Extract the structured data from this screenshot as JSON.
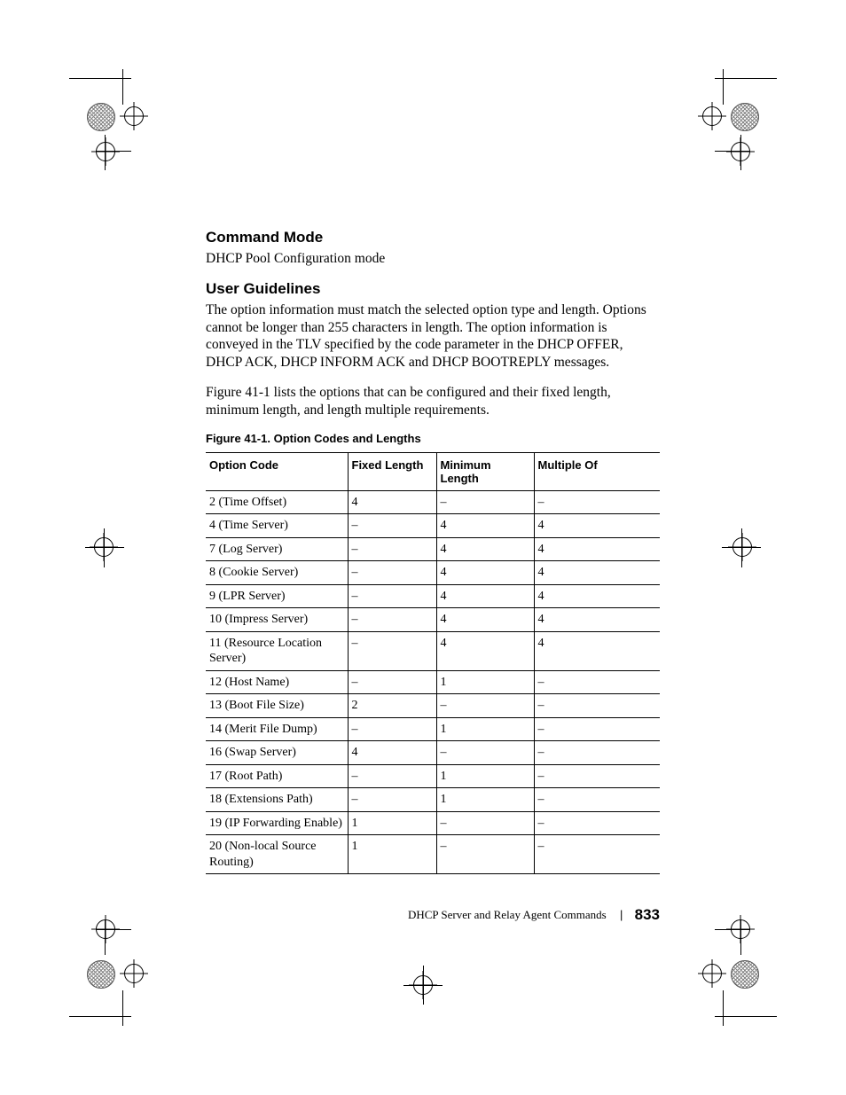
{
  "sections": {
    "command_mode": {
      "heading": "Command Mode",
      "body": "DHCP Pool Configuration mode"
    },
    "user_guidelines": {
      "heading": "User Guidelines",
      "para1": "The option information must match the selected option type and length. Options cannot be longer than 255 characters in length. The option information is conveyed in the TLV specified by the code parameter in the DHCP OFFER, DHCP ACK, DHCP INFORM ACK and DHCP BOOTREPLY messages.",
      "para2": "Figure 41-1 lists the options that can be configured and their fixed length, minimum length, and length multiple requirements."
    }
  },
  "figure_caption": "Figure 41-1.    Option Codes and Lengths",
  "table": {
    "headers": [
      "Option Code",
      "Fixed Length",
      "Minimum Length",
      "Multiple Of"
    ],
    "rows": [
      [
        "2 (Time Offset)",
        "4",
        "–",
        "–"
      ],
      [
        "4 (Time Server)",
        "–",
        "4",
        "4"
      ],
      [
        "7 (Log Server)",
        "–",
        "4",
        "4"
      ],
      [
        "8 (Cookie Server)",
        "–",
        "4",
        "4"
      ],
      [
        "9 (LPR Server)",
        "–",
        "4",
        "4"
      ],
      [
        "10 (Impress Server)",
        "–",
        "4",
        "4"
      ],
      [
        "11 (Resource Location Server)",
        "–",
        "4",
        "4"
      ],
      [
        "12 (Host Name)",
        "–",
        "1",
        "–"
      ],
      [
        "13 (Boot File Size)",
        "2",
        "–",
        "–"
      ],
      [
        "14 (Merit File Dump)",
        "–",
        "1",
        "–"
      ],
      [
        "16 (Swap Server)",
        "4",
        "–",
        "–"
      ],
      [
        "17 (Root Path)",
        "–",
        "1",
        "–"
      ],
      [
        "18 (Extensions Path)",
        "–",
        "1",
        "–"
      ],
      [
        "19 (IP Forwarding Enable)",
        "1",
        "–",
        "–"
      ],
      [
        "20 (Non-local Source Routing)",
        "1",
        "–",
        "–"
      ]
    ]
  },
  "footer": {
    "section": "DHCP Server and Relay Agent Commands",
    "page": "833"
  }
}
